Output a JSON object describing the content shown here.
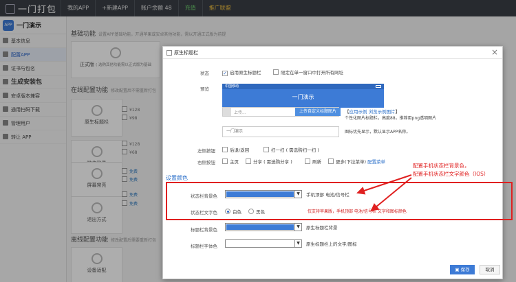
{
  "topbar": {
    "brand": "一门打包",
    "nav": [
      "我的APP",
      "+新建APP",
      "账户余额 48",
      "充值",
      "推广联盟"
    ]
  },
  "sidebar": {
    "app_icon_text": "APP",
    "app_name": "一门演示",
    "items": [
      "基本信息",
      "配置APP",
      "证书与包名",
      "生成安装包",
      "安卓版本兼容",
      "通用扫码下载",
      "管理用户",
      "转让 APP"
    ]
  },
  "content": {
    "basic_title": "基础功能",
    "basic_desc": "设置APP基础功能，开通苹果或安卓其他功能，需以开通正式版为前提",
    "official_label": "正式版",
    "official_desc": "( 选购其他功能需以正式版为基础",
    "online_title": "在线配置功能",
    "online_desc": "修改配置后不需重新打包",
    "offline_title": "离线配置功能",
    "offline_desc": "修改配置后需要重新打包",
    "tiles": [
      "原生标题栏",
      "微信登录",
      "屏幕常亮",
      "退出方式",
      "设备适配"
    ],
    "prices": [
      "¥128",
      "¥98",
      "¥128",
      "¥68",
      "免费",
      "免费",
      "免费",
      "免费"
    ]
  },
  "modal": {
    "title": "原生标题栏",
    "close": "×",
    "status_label": "状态",
    "status_enable": "启用原生标题栏",
    "status_new_window": "限定在单一窗口中打开所有网址",
    "preview_label": "预览",
    "preview_carrier": "中国移动",
    "preview_title": "一门演示",
    "upload_placeholder": "上传...",
    "upload_button": "上传自定义标题图片",
    "app_icon_link": "应用示例",
    "browse_link": "浏览示例图片",
    "custom_hint": "个性化图片标题栏，高度88，推荐用png透明图片",
    "title_input": "一门演示",
    "title_hint": "图标优先显示，默认显示APP名称。",
    "left_label": "左侧按钮",
    "left_options": [
      "后退/返回",
      "扫一扫 ( 需选购扫一扫 )"
    ],
    "right_label": "右侧按钮",
    "right_options": [
      "主页",
      "分享 ( 需选购分享 )",
      "刷新",
      "更多(下拉菜单)"
    ],
    "config_menu": "配置菜单",
    "color_section": "设置颜色",
    "status_bg_label": "状态栏背景色",
    "status_bg_hint": "手机顶部 电池/信号栏",
    "status_text_label": "状态栏文字色",
    "status_text_white": "白色",
    "status_text_black": "黑色",
    "status_text_hint": "仅支持苹果版，手机顶部 电池/信号栏 文字和图标颜色",
    "title_bg_label": "标题栏背景色",
    "title_bg_hint": "原生标题栏背景",
    "title_font_label": "标题栏字体色",
    "title_font_hint": "原生标题栏上的文字/图标",
    "save": "保存",
    "cancel": "取消"
  },
  "annotation": {
    "line1": "配置手机状态栏背景色，",
    "line2": "配置手机状态栏文字颜色（IOS）"
  },
  "colors": {
    "status_bg": "#3d7bd6",
    "title_bg": "#3d7bd6",
    "title_font": "#ffffff",
    "accent": "#2a6fc9",
    "annotation": "#e02020"
  }
}
